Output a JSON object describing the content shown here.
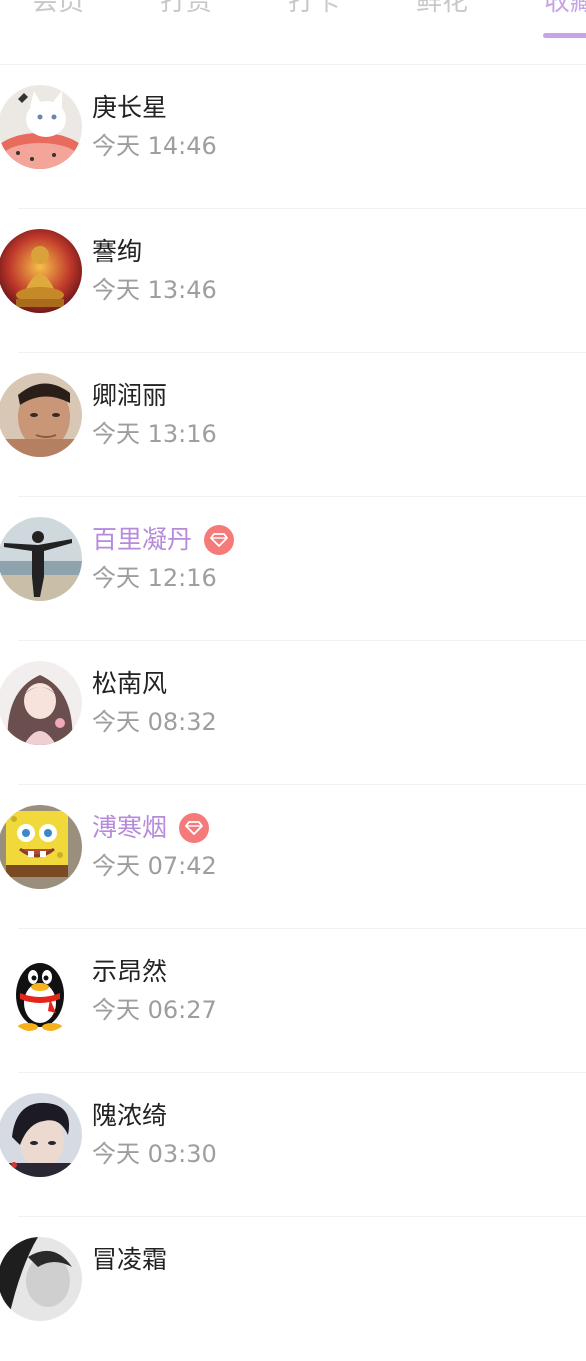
{
  "tabs": [
    {
      "label": "会员",
      "active": false
    },
    {
      "label": "打赏",
      "active": false
    },
    {
      "label": "打卡",
      "active": false
    },
    {
      "label": "鲜花",
      "active": false
    },
    {
      "label": "收藏",
      "active": true
    }
  ],
  "colors": {
    "accent": "#c6a4e6",
    "vip_name": "#b78bdc",
    "vip_badge": "#f57b7b",
    "name": "#222222",
    "time": "#9e9e9e"
  },
  "rows": [
    {
      "name": "庚长星",
      "time": "今天 14:46",
      "vip": false,
      "avatar": "cat-avatar"
    },
    {
      "name": "謇绚",
      "time": "今天 13:46",
      "vip": false,
      "avatar": "buddha-avatar"
    },
    {
      "name": "卿润丽",
      "time": "今天 13:16",
      "vip": false,
      "avatar": "man-avatar"
    },
    {
      "name": "百里凝丹",
      "time": "今天 12:16",
      "vip": true,
      "avatar": "beach-avatar"
    },
    {
      "name": "松南风",
      "time": "今天 08:32",
      "vip": false,
      "avatar": "anime-girl-avatar"
    },
    {
      "name": "溥寒烟",
      "time": "今天 07:42",
      "vip": true,
      "avatar": "sponge-avatar"
    },
    {
      "name": "示昂然",
      "time": "今天 06:27",
      "vip": false,
      "avatar": "penguin-avatar"
    },
    {
      "name": "隗浓绮",
      "time": "今天 03:30",
      "vip": false,
      "avatar": "boy-avatar"
    },
    {
      "name": "冒凌霜",
      "time": "",
      "vip": false,
      "avatar": "bw-avatar"
    }
  ]
}
